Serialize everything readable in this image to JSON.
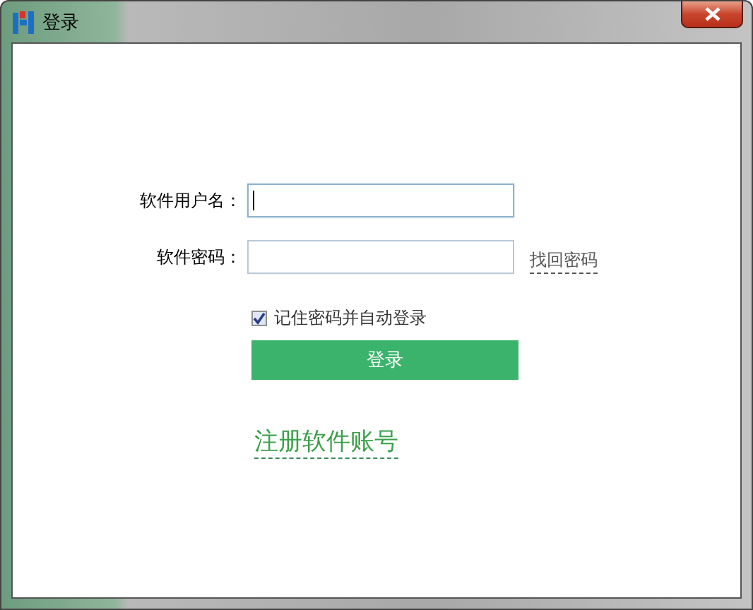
{
  "window": {
    "title": "登录"
  },
  "fields": [
    {
      "label": "软件用户名：",
      "focused": true
    },
    {
      "label": "软件密码：",
      "focused": false,
      "link": "找回密码"
    }
  ],
  "remember": {
    "label": "记住密码并自动登录",
    "checked": true
  },
  "login_button": "登录",
  "register_link": "注册软件账号"
}
